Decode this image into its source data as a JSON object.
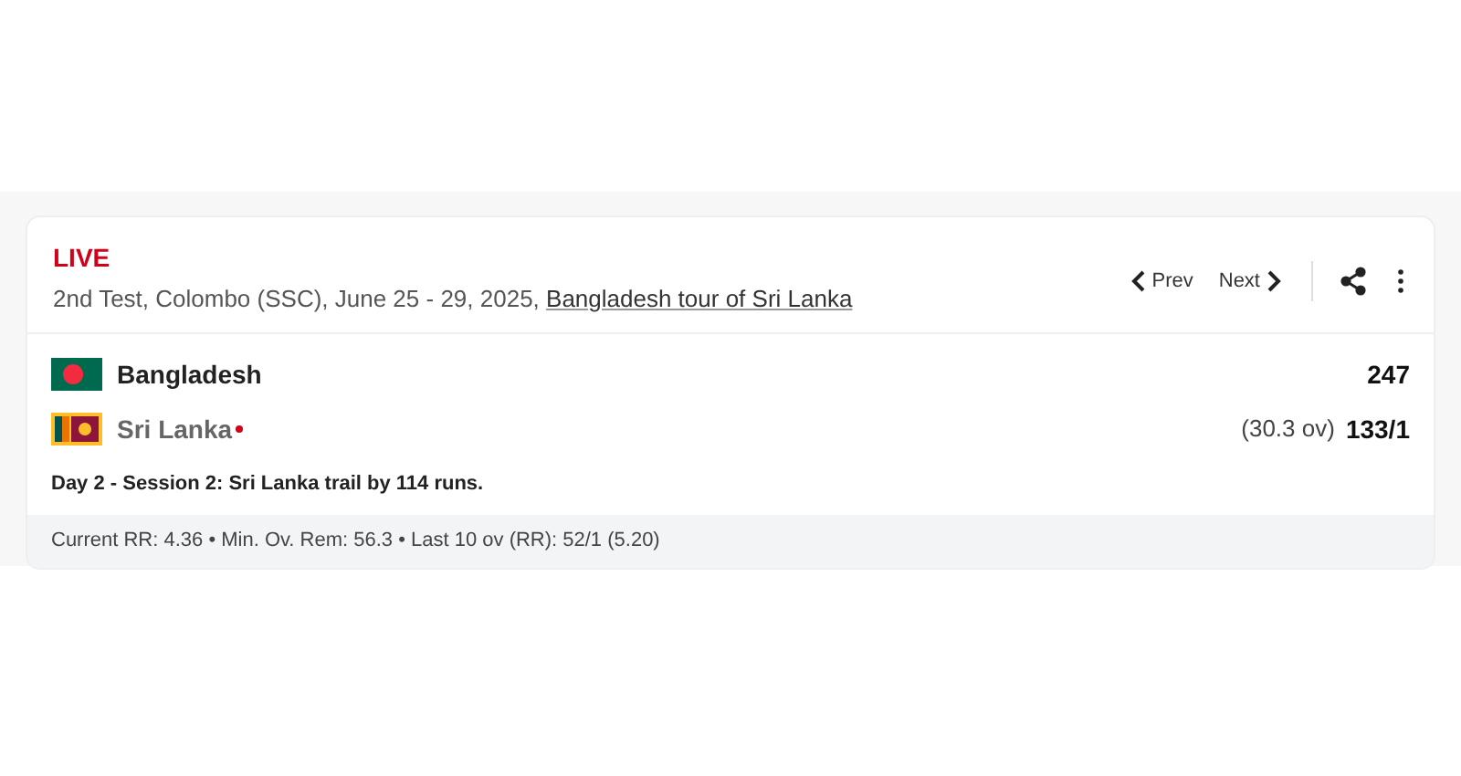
{
  "match": {
    "status": "LIVE",
    "description": "2nd Test, Colombo (SSC), June 25 - 29, 2025, ",
    "series_link": "Bangladesh tour of Sri Lanka"
  },
  "nav": {
    "prev": "Prev",
    "next": "Next"
  },
  "teams": [
    {
      "kind": "bangladesh",
      "name": "Bangladesh",
      "batting": false,
      "score": "247"
    },
    {
      "kind": "srilanka",
      "name": "Sri Lanka",
      "batting": true,
      "overs": "(30.3 ov)",
      "score": "133/1"
    }
  ],
  "status_text": "Day 2 - Session 2: Sri Lanka trail by 114 runs.",
  "footer": "Current RR: 4.36 • Min. Ov. Rem: 56.3 • Last 10 ov (RR): 52/1 (5.20)"
}
